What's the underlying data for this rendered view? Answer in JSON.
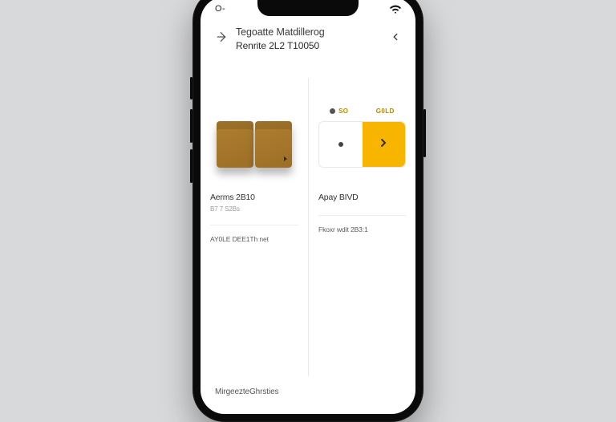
{
  "status": {
    "left": "O-"
  },
  "header": {
    "title": "Tegoatte Matdillerog",
    "subtitle": "Renrite 2L2 T10050"
  },
  "left": {
    "info_title": "Aerms 2B10",
    "info_sub": "B7 7 S2Bs",
    "meta": "AY0LE DEE1Th net"
  },
  "right": {
    "opt1": "SO",
    "opt2": "G0LD",
    "info_title": "Apay BIVD",
    "meta": "Fkoxr wdit 2B3:1"
  },
  "footer": {
    "label": "MirgeezteGhrsties"
  }
}
